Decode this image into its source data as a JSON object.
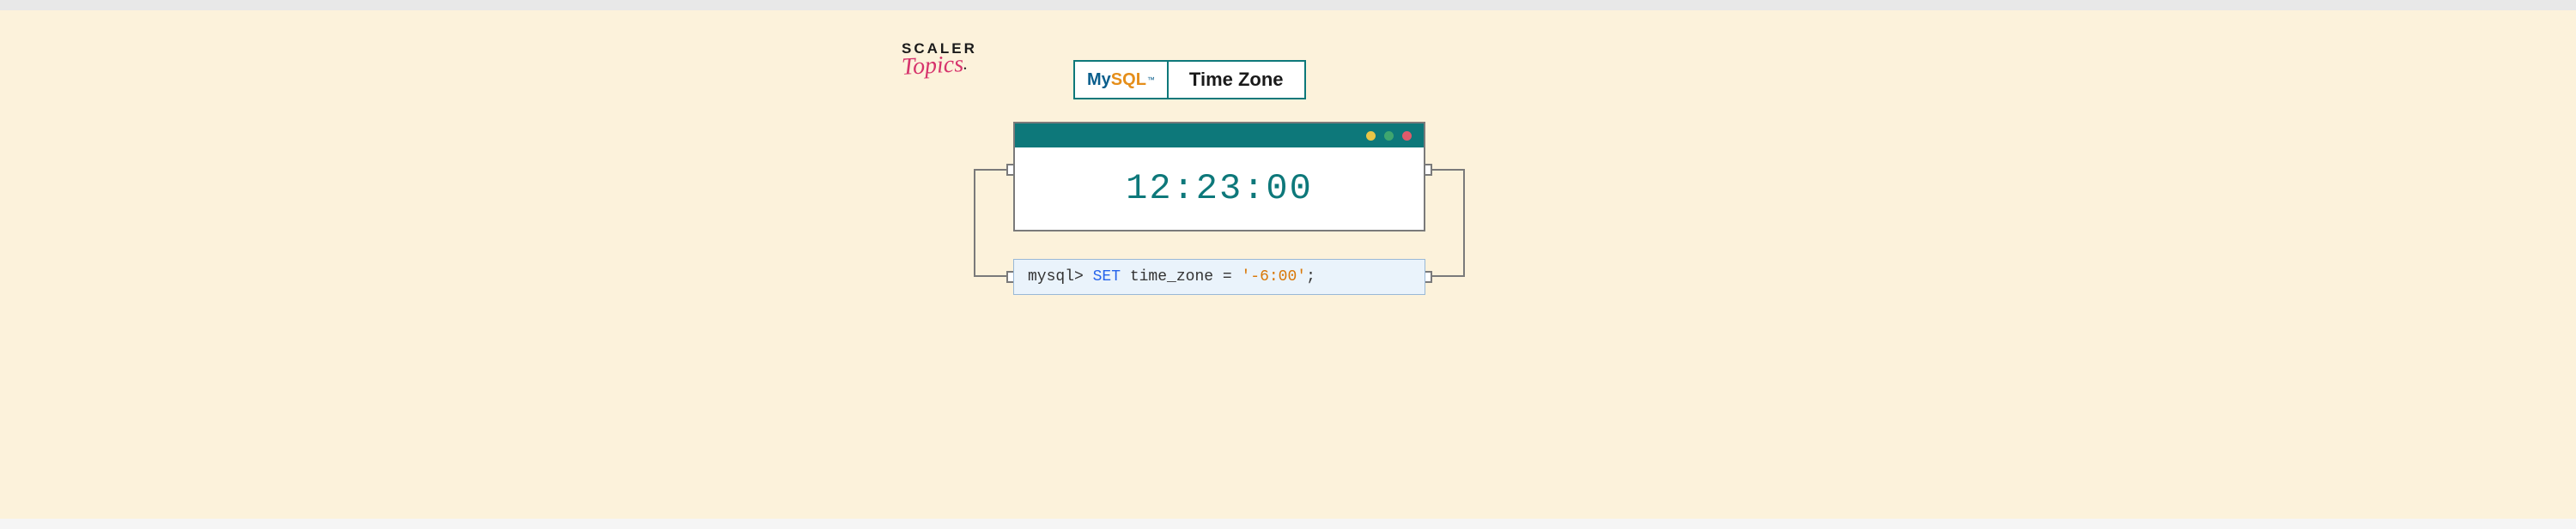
{
  "logo": {
    "line1": "SCALER",
    "line2": "Topics"
  },
  "header": {
    "mysql_my": "My",
    "mysql_sql": "SQL",
    "mysql_tm": "™",
    "title": "Time Zone"
  },
  "terminal": {
    "dots": [
      "#e8c547",
      "#3fa66f",
      "#e05a6b"
    ],
    "time": "12:23:00"
  },
  "code": {
    "prompt": "mysql> ",
    "keyword": "SET",
    "var": " time_zone = ",
    "value": "'-6:00'",
    "end": ";"
  }
}
